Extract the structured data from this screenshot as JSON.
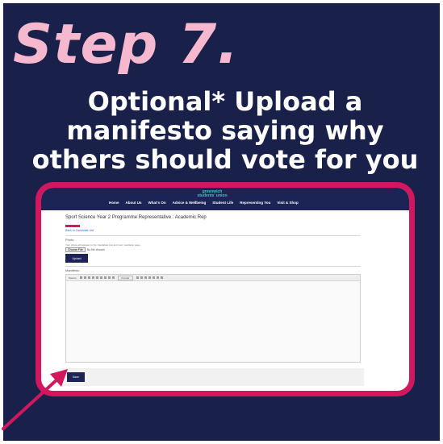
{
  "step": "Step 7.",
  "headline": {
    "line1": "Optional* Upload a",
    "line2": "manifesto saying why",
    "line3": "others should vote for you"
  },
  "screenshot": {
    "logo_line1": "greenwich",
    "logo_line2": "students' union",
    "user_badge": "Lee",
    "nav": [
      "Home",
      "About Us",
      "What's On",
      "Advice & Wellbeing",
      "Student Life",
      "Representing You",
      "Visit & Shop"
    ],
    "post_title": "Sport Science Year 2 Programme Representative : Academic Rep",
    "back_link": "Back to Candidate List",
    "photo_legend": "Photo",
    "photo_hint": "Your photo will appear on the Candidate List and your manifesto page.",
    "choose_file": "Choose File",
    "no_file": "No file chosen",
    "upload": "Upload",
    "manifesto_legend": "Manifesto",
    "source_label": "Source",
    "format_label": "Format",
    "save": "Save"
  },
  "colors": {
    "background": "#19214a",
    "step_pink": "#f6b8cf",
    "frame_pink": "#d1175e",
    "nav_navy": "#1b2454"
  },
  "icons": [
    "arrow-pointer-icon"
  ]
}
